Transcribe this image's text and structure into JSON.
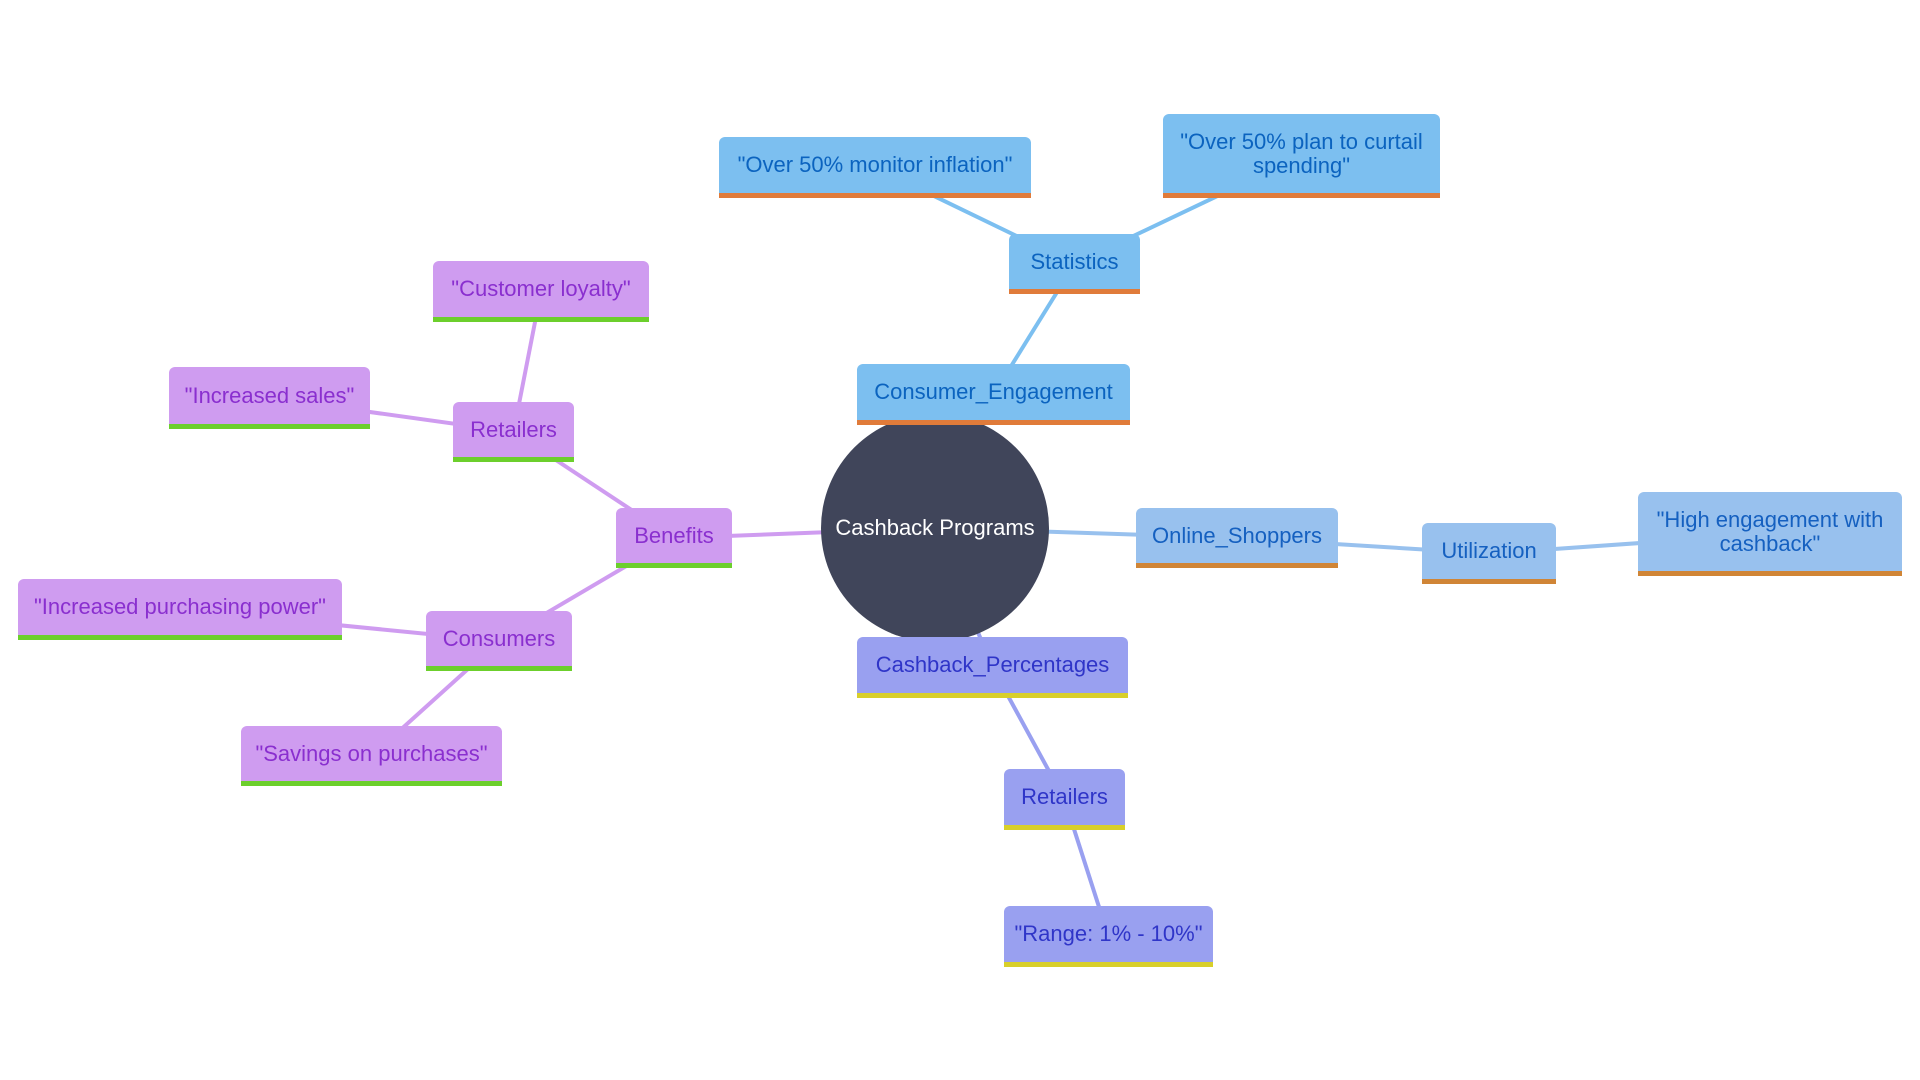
{
  "title": "Cashback Programs",
  "colors": {
    "root_fill": "#40455a",
    "consumer_engagement_branch": "#7cbff0",
    "online_shoppers_branch": "#98c1ee",
    "cashback_percentages_branch": "#99a0f0",
    "benefits_branch": "#cf9cf0"
  },
  "nodes": {
    "root": "Cashback Programs",
    "consumer_engagement": "Consumer_Engagement",
    "statistics": "Statistics",
    "monitor_inflation": "\"Over 50% monitor inflation\"",
    "curtail_spending": "\"Over 50% plan to curtail spending\"",
    "online_shoppers": "Online_Shoppers",
    "utilization": "Utilization",
    "high_engagement": "\"High engagement with cashback\"",
    "cashback_percentages": "Cashback_Percentages",
    "pct_retailers": "Retailers",
    "range": "\"Range: 1% - 10%\"",
    "benefits": "Benefits",
    "benefit_retailers": "Retailers",
    "customer_loyalty": "\"Customer loyalty\"",
    "increased_sales": "\"Increased sales\"",
    "consumers": "Consumers",
    "purchasing_power": "\"Increased purchasing power\"",
    "savings": "\"Savings on purchases\""
  },
  "edges": [
    [
      "root",
      "consumer_engagement"
    ],
    [
      "consumer_engagement",
      "statistics"
    ],
    [
      "statistics",
      "monitor_inflation"
    ],
    [
      "statistics",
      "curtail_spending"
    ],
    [
      "root",
      "online_shoppers"
    ],
    [
      "online_shoppers",
      "utilization"
    ],
    [
      "utilization",
      "high_engagement"
    ],
    [
      "root",
      "cashback_percentages"
    ],
    [
      "cashback_percentages",
      "pct_retailers"
    ],
    [
      "pct_retailers",
      "range"
    ],
    [
      "root",
      "benefits"
    ],
    [
      "benefits",
      "benefit_retailers"
    ],
    [
      "benefit_retailers",
      "customer_loyalty"
    ],
    [
      "benefit_retailers",
      "increased_sales"
    ],
    [
      "benefits",
      "consumers"
    ],
    [
      "consumers",
      "purchasing_power"
    ],
    [
      "consumers",
      "savings"
    ]
  ]
}
